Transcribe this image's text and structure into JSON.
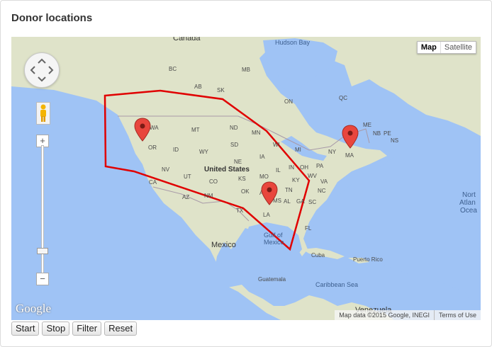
{
  "panel": {
    "title": "Donor locations"
  },
  "map": {
    "type_controls": {
      "map_label": "Map",
      "satellite_label": "Satellite"
    },
    "logo": "Google",
    "attribution": "Map data ©2015 Google, INEGI",
    "terms": "Terms of Use",
    "labels": {
      "canada": "Canada",
      "hudson_bay": "Hudson Bay",
      "united_states": "United States",
      "mexico": "Mexico",
      "gulf": "Gulf of\nMexico",
      "cuba": "Cuba",
      "puerto_rico": "Puerto Rico",
      "guatemala": "Guatemala",
      "caribbean": "Caribbean Sea",
      "venezuela": "Venezuela",
      "ocean1": "Nort",
      "ocean2": "Atlan",
      "ocean3": "Ocea",
      "ab": "AB",
      "mb": "MB",
      "sk": "SK",
      "bc": "BC",
      "on": "ON",
      "qc": "QC",
      "nb": "NB",
      "ns": "NS",
      "pe": "PE",
      "wa": "WA",
      "or": "OR",
      "id": "ID",
      "mt": "MT",
      "wy": "WY",
      "nd": "ND",
      "sd": "SD",
      "ne": "NE",
      "mn": "MN",
      "wi": "WI",
      "mi": "MI",
      "ia": "IA",
      "il": "IL",
      "in": "IN",
      "oh": "OH",
      "pa": "PA",
      "ny": "NY",
      "ma": "MA",
      "nv": "NV",
      "ut": "UT",
      "co": "CO",
      "ks": "KS",
      "mo": "MO",
      "ky": "KY",
      "wv": "WV",
      "va": "VA",
      "nc": "NC",
      "tn": "TN",
      "sc": "SC",
      "ca": "CA",
      "az": "AZ",
      "nm": "NM",
      "ok": "OK",
      "ar": "AR",
      "ms": "MS",
      "al": "AL",
      "ga": "GA",
      "la": "LA",
      "tx": "TX",
      "fl": "FL",
      "me": "ME"
    },
    "markers": [
      "Oregon marker",
      "Louisiana marker",
      "Massachusetts marker"
    ],
    "polygon_color": "#e00000",
    "marker_color": "#e8463d"
  },
  "controls": {
    "start": "Start",
    "stop": "Stop",
    "filter": "Filter",
    "reset": "Reset"
  }
}
